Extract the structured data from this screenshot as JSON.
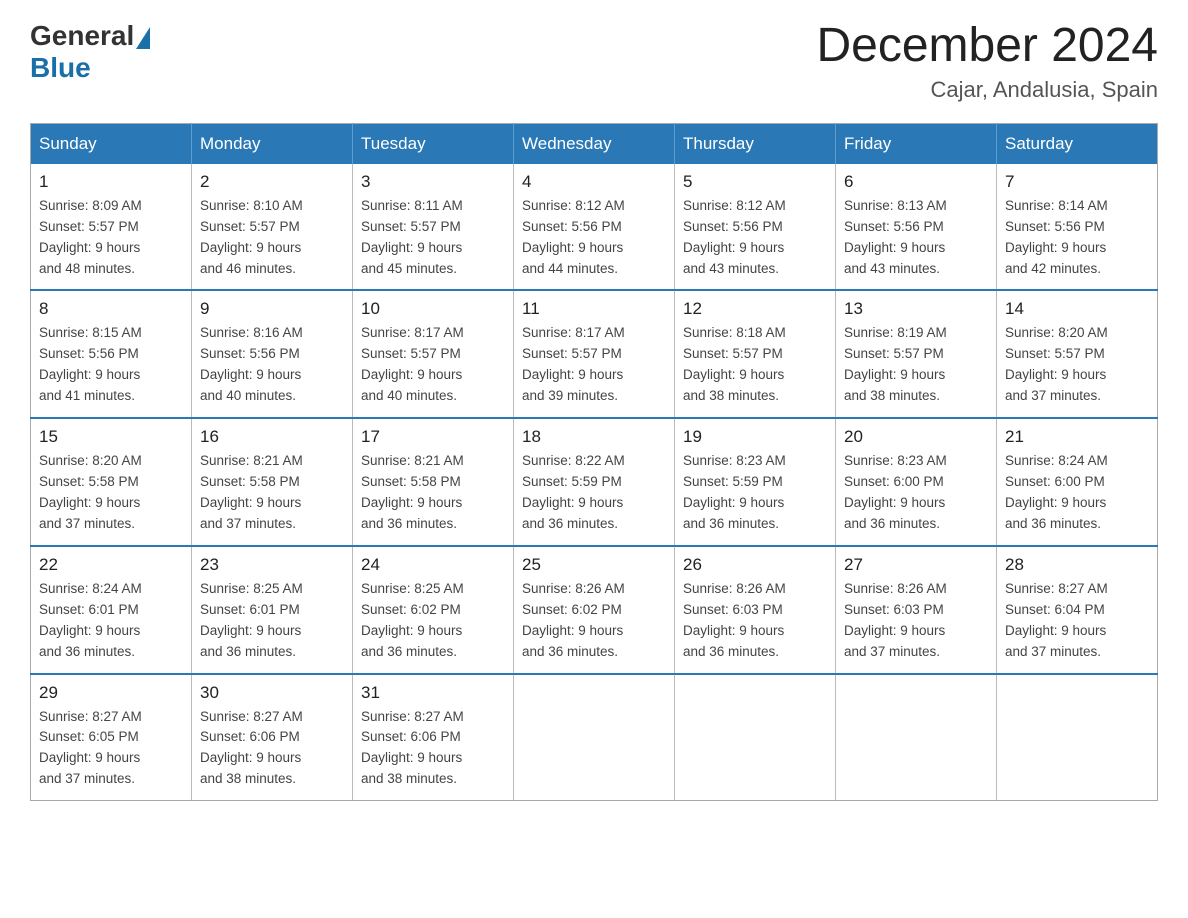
{
  "logo": {
    "general": "General",
    "blue": "Blue"
  },
  "title": {
    "month_year": "December 2024",
    "location": "Cajar, Andalusia, Spain"
  },
  "headers": [
    "Sunday",
    "Monday",
    "Tuesday",
    "Wednesday",
    "Thursday",
    "Friday",
    "Saturday"
  ],
  "weeks": [
    [
      {
        "day": "1",
        "sunrise": "Sunrise: 8:09 AM",
        "sunset": "Sunset: 5:57 PM",
        "daylight": "Daylight: 9 hours",
        "daylight2": "and 48 minutes."
      },
      {
        "day": "2",
        "sunrise": "Sunrise: 8:10 AM",
        "sunset": "Sunset: 5:57 PM",
        "daylight": "Daylight: 9 hours",
        "daylight2": "and 46 minutes."
      },
      {
        "day": "3",
        "sunrise": "Sunrise: 8:11 AM",
        "sunset": "Sunset: 5:57 PM",
        "daylight": "Daylight: 9 hours",
        "daylight2": "and 45 minutes."
      },
      {
        "day": "4",
        "sunrise": "Sunrise: 8:12 AM",
        "sunset": "Sunset: 5:56 PM",
        "daylight": "Daylight: 9 hours",
        "daylight2": "and 44 minutes."
      },
      {
        "day": "5",
        "sunrise": "Sunrise: 8:12 AM",
        "sunset": "Sunset: 5:56 PM",
        "daylight": "Daylight: 9 hours",
        "daylight2": "and 43 minutes."
      },
      {
        "day": "6",
        "sunrise": "Sunrise: 8:13 AM",
        "sunset": "Sunset: 5:56 PM",
        "daylight": "Daylight: 9 hours",
        "daylight2": "and 43 minutes."
      },
      {
        "day": "7",
        "sunrise": "Sunrise: 8:14 AM",
        "sunset": "Sunset: 5:56 PM",
        "daylight": "Daylight: 9 hours",
        "daylight2": "and 42 minutes."
      }
    ],
    [
      {
        "day": "8",
        "sunrise": "Sunrise: 8:15 AM",
        "sunset": "Sunset: 5:56 PM",
        "daylight": "Daylight: 9 hours",
        "daylight2": "and 41 minutes."
      },
      {
        "day": "9",
        "sunrise": "Sunrise: 8:16 AM",
        "sunset": "Sunset: 5:56 PM",
        "daylight": "Daylight: 9 hours",
        "daylight2": "and 40 minutes."
      },
      {
        "day": "10",
        "sunrise": "Sunrise: 8:17 AM",
        "sunset": "Sunset: 5:57 PM",
        "daylight": "Daylight: 9 hours",
        "daylight2": "and 40 minutes."
      },
      {
        "day": "11",
        "sunrise": "Sunrise: 8:17 AM",
        "sunset": "Sunset: 5:57 PM",
        "daylight": "Daylight: 9 hours",
        "daylight2": "and 39 minutes."
      },
      {
        "day": "12",
        "sunrise": "Sunrise: 8:18 AM",
        "sunset": "Sunset: 5:57 PM",
        "daylight": "Daylight: 9 hours",
        "daylight2": "and 38 minutes."
      },
      {
        "day": "13",
        "sunrise": "Sunrise: 8:19 AM",
        "sunset": "Sunset: 5:57 PM",
        "daylight": "Daylight: 9 hours",
        "daylight2": "and 38 minutes."
      },
      {
        "day": "14",
        "sunrise": "Sunrise: 8:20 AM",
        "sunset": "Sunset: 5:57 PM",
        "daylight": "Daylight: 9 hours",
        "daylight2": "and 37 minutes."
      }
    ],
    [
      {
        "day": "15",
        "sunrise": "Sunrise: 8:20 AM",
        "sunset": "Sunset: 5:58 PM",
        "daylight": "Daylight: 9 hours",
        "daylight2": "and 37 minutes."
      },
      {
        "day": "16",
        "sunrise": "Sunrise: 8:21 AM",
        "sunset": "Sunset: 5:58 PM",
        "daylight": "Daylight: 9 hours",
        "daylight2": "and 37 minutes."
      },
      {
        "day": "17",
        "sunrise": "Sunrise: 8:21 AM",
        "sunset": "Sunset: 5:58 PM",
        "daylight": "Daylight: 9 hours",
        "daylight2": "and 36 minutes."
      },
      {
        "day": "18",
        "sunrise": "Sunrise: 8:22 AM",
        "sunset": "Sunset: 5:59 PM",
        "daylight": "Daylight: 9 hours",
        "daylight2": "and 36 minutes."
      },
      {
        "day": "19",
        "sunrise": "Sunrise: 8:23 AM",
        "sunset": "Sunset: 5:59 PM",
        "daylight": "Daylight: 9 hours",
        "daylight2": "and 36 minutes."
      },
      {
        "day": "20",
        "sunrise": "Sunrise: 8:23 AM",
        "sunset": "Sunset: 6:00 PM",
        "daylight": "Daylight: 9 hours",
        "daylight2": "and 36 minutes."
      },
      {
        "day": "21",
        "sunrise": "Sunrise: 8:24 AM",
        "sunset": "Sunset: 6:00 PM",
        "daylight": "Daylight: 9 hours",
        "daylight2": "and 36 minutes."
      }
    ],
    [
      {
        "day": "22",
        "sunrise": "Sunrise: 8:24 AM",
        "sunset": "Sunset: 6:01 PM",
        "daylight": "Daylight: 9 hours",
        "daylight2": "and 36 minutes."
      },
      {
        "day": "23",
        "sunrise": "Sunrise: 8:25 AM",
        "sunset": "Sunset: 6:01 PM",
        "daylight": "Daylight: 9 hours",
        "daylight2": "and 36 minutes."
      },
      {
        "day": "24",
        "sunrise": "Sunrise: 8:25 AM",
        "sunset": "Sunset: 6:02 PM",
        "daylight": "Daylight: 9 hours",
        "daylight2": "and 36 minutes."
      },
      {
        "day": "25",
        "sunrise": "Sunrise: 8:26 AM",
        "sunset": "Sunset: 6:02 PM",
        "daylight": "Daylight: 9 hours",
        "daylight2": "and 36 minutes."
      },
      {
        "day": "26",
        "sunrise": "Sunrise: 8:26 AM",
        "sunset": "Sunset: 6:03 PM",
        "daylight": "Daylight: 9 hours",
        "daylight2": "and 36 minutes."
      },
      {
        "day": "27",
        "sunrise": "Sunrise: 8:26 AM",
        "sunset": "Sunset: 6:03 PM",
        "daylight": "Daylight: 9 hours",
        "daylight2": "and 37 minutes."
      },
      {
        "day": "28",
        "sunrise": "Sunrise: 8:27 AM",
        "sunset": "Sunset: 6:04 PM",
        "daylight": "Daylight: 9 hours",
        "daylight2": "and 37 minutes."
      }
    ],
    [
      {
        "day": "29",
        "sunrise": "Sunrise: 8:27 AM",
        "sunset": "Sunset: 6:05 PM",
        "daylight": "Daylight: 9 hours",
        "daylight2": "and 37 minutes."
      },
      {
        "day": "30",
        "sunrise": "Sunrise: 8:27 AM",
        "sunset": "Sunset: 6:06 PM",
        "daylight": "Daylight: 9 hours",
        "daylight2": "and 38 minutes."
      },
      {
        "day": "31",
        "sunrise": "Sunrise: 8:27 AM",
        "sunset": "Sunset: 6:06 PM",
        "daylight": "Daylight: 9 hours",
        "daylight2": "and 38 minutes."
      },
      null,
      null,
      null,
      null
    ]
  ]
}
